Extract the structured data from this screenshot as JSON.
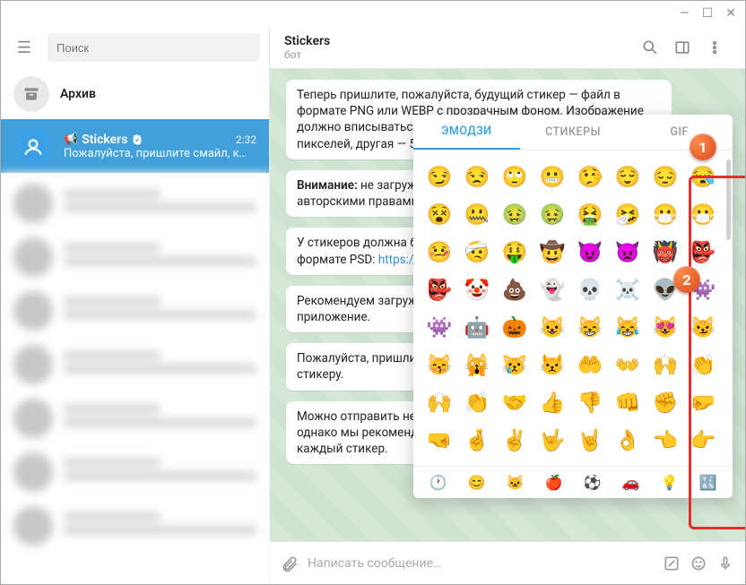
{
  "window": {
    "minimize": "—",
    "maximize": "☐",
    "close": "✕"
  },
  "sidebar": {
    "search_placeholder": "Поиск",
    "archive": "Архив",
    "active_chat": {
      "name": "Stickers",
      "time": "2:32",
      "subtitle": "Пожалуйста, пришлите смайл, к…"
    }
  },
  "chat": {
    "title": "Stickers",
    "subtitle": "бот",
    "composer_placeholder": "Написать сообщение…",
    "messages": [
      "Теперь пришлите, пожалуйста, будущий стикер — файл в формате PNG или WEBP с прозрачным фоном. Изображение должно вписываться в квадрат <b>512x512</b> (одна сторона — 512 пикселей, другая — 512 или меньше).",
      "<b>Внимание:</b> не загружайте изображения, защищённые авторскими правами.",
      "У стикеров должна быть белая обводка и тень (пример в формате PSD: <a href='#'>https://telegram.org/img/…</a>)",
      "Рекомендуем загружать стикеры через десктопное приложение.",
      "Пожалуйста, пришлите эмодзи, который соответствует вашему стикеру.",
      "Можно отправить несколько эмодзи в одном сообщении, однако мы рекомендуем использовать не более двух на каждый стикер."
    ]
  },
  "emoji_panel": {
    "tabs": [
      "ЭМОДЗИ",
      "СТИКЕРЫ",
      "GIF"
    ],
    "rows": [
      [
        "😏",
        "😒",
        "🙄",
        "😬",
        "🤥",
        "😌",
        "😔",
        "😪"
      ],
      [
        "😵",
        "🤐",
        "🤢",
        "🤢",
        "🤮",
        "🤧",
        "😷",
        "😷"
      ],
      [
        "🤒",
        "🤕",
        "🤑",
        "🤠",
        "😈",
        "👿",
        "👹",
        "👺"
      ],
      [
        "👺",
        "🤡",
        "💩",
        "👻",
        "💀",
        "☠️",
        "👽",
        "👾"
      ],
      [
        "👾",
        "🤖",
        "🎃",
        "😺",
        "😸",
        "😹",
        "😻",
        "😼"
      ],
      [
        "😽",
        "🙀",
        "😿",
        "😾",
        "🤲",
        "👐",
        "🙌",
        "👏"
      ],
      [
        "🙌",
        "👏",
        "🤝",
        "👍",
        "👎",
        "👊",
        "✊",
        "🤛"
      ],
      [
        "🤜",
        "🤞",
        "✌️",
        "🤟",
        "🤘",
        "👌",
        "👈",
        "👉"
      ]
    ],
    "categories": [
      "🕐",
      "😊",
      "🐱",
      "🍎",
      "⚽",
      "🚗",
      "💡",
      "🔣"
    ]
  },
  "callouts": {
    "one": "1",
    "two": "2"
  }
}
